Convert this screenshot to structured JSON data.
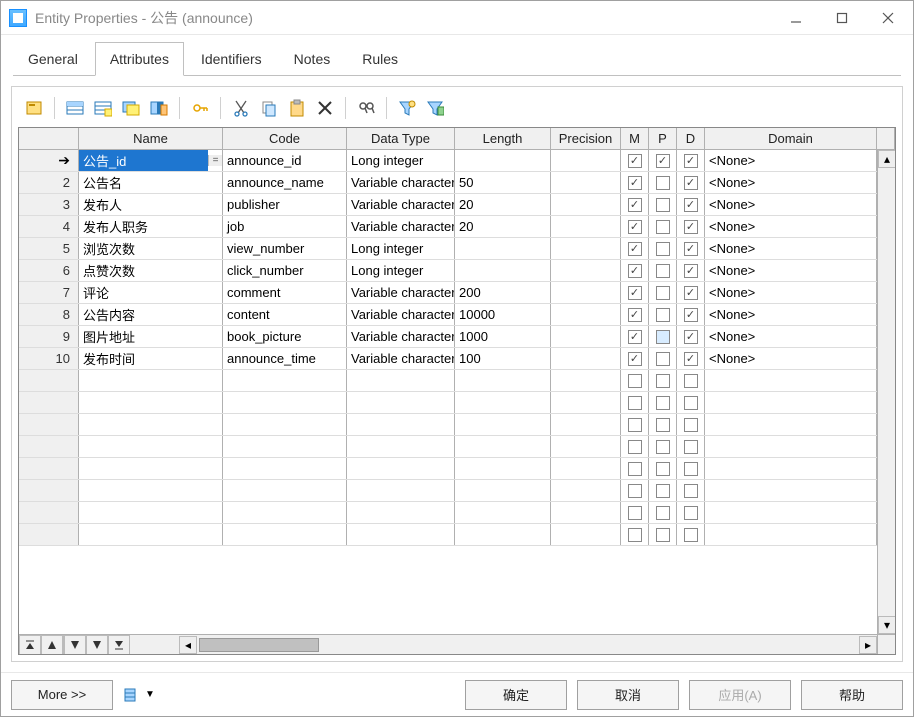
{
  "window": {
    "title": "Entity Properties - 公告 (announce)"
  },
  "tabs": [
    {
      "label": "General",
      "active": false
    },
    {
      "label": "Attributes",
      "active": true
    },
    {
      "label": "Identifiers",
      "active": false
    },
    {
      "label": "Notes",
      "active": false
    },
    {
      "label": "Rules",
      "active": false
    }
  ],
  "grid": {
    "columns": {
      "name": "Name",
      "code": "Code",
      "datatype": "Data Type",
      "length": "Length",
      "precision": "Precision",
      "m": "M",
      "p": "P",
      "d": "D",
      "domain": "Domain"
    },
    "rows": [
      {
        "num": "",
        "arrow": true,
        "name": "公告_id",
        "code": "announce_id",
        "datatype": "Long integer",
        "length": "",
        "precision": "",
        "m": true,
        "p": true,
        "d": true,
        "domain": "<None>",
        "selected": true
      },
      {
        "num": "2",
        "name": "公告名",
        "code": "announce_name",
        "datatype": "Variable characters",
        "length": "50",
        "precision": "",
        "m": true,
        "p": false,
        "d": true,
        "domain": "<None>"
      },
      {
        "num": "3",
        "name": "发布人",
        "code": "publisher",
        "datatype": "Variable characters",
        "length": "20",
        "precision": "",
        "m": true,
        "p": false,
        "d": true,
        "domain": "<None>"
      },
      {
        "num": "4",
        "name": "发布人职务",
        "code": "job",
        "datatype": "Variable characters",
        "length": "20",
        "precision": "",
        "m": true,
        "p": false,
        "d": true,
        "domain": "<None>"
      },
      {
        "num": "5",
        "name": "浏览次数",
        "code": "view_number",
        "datatype": "Long integer",
        "length": "",
        "precision": "",
        "m": true,
        "p": false,
        "d": true,
        "domain": "<None>"
      },
      {
        "num": "6",
        "name": "点赞次数",
        "code": "click_number",
        "datatype": "Long integer",
        "length": "",
        "precision": "",
        "m": true,
        "p": false,
        "d": true,
        "domain": "<None>"
      },
      {
        "num": "7",
        "name": "评论",
        "code": "comment",
        "datatype": "Variable characters",
        "length": "200",
        "precision": "",
        "m": true,
        "p": false,
        "d": true,
        "domain": "<None>"
      },
      {
        "num": "8",
        "name": "公告内容",
        "code": "content",
        "datatype": "Variable characters",
        "length": "10000",
        "precision": "",
        "m": true,
        "p": false,
        "d": true,
        "domain": "<None>"
      },
      {
        "num": "9",
        "name": "图片地址",
        "code": "book_picture",
        "datatype": "Variable characters",
        "length": "1000",
        "precision": "",
        "m": true,
        "p": false,
        "d": true,
        "domain": "<None>",
        "phighlight": true
      },
      {
        "num": "10",
        "name": "发布时间",
        "code": "announce_time",
        "datatype": "Variable characters",
        "length": "100",
        "precision": "",
        "m": true,
        "p": false,
        "d": true,
        "domain": "<None>"
      }
    ],
    "empty_rows": 8
  },
  "buttons": {
    "more": "More >>",
    "ok": "确定",
    "cancel": "取消",
    "apply": "应用(A)",
    "help": "帮助"
  }
}
